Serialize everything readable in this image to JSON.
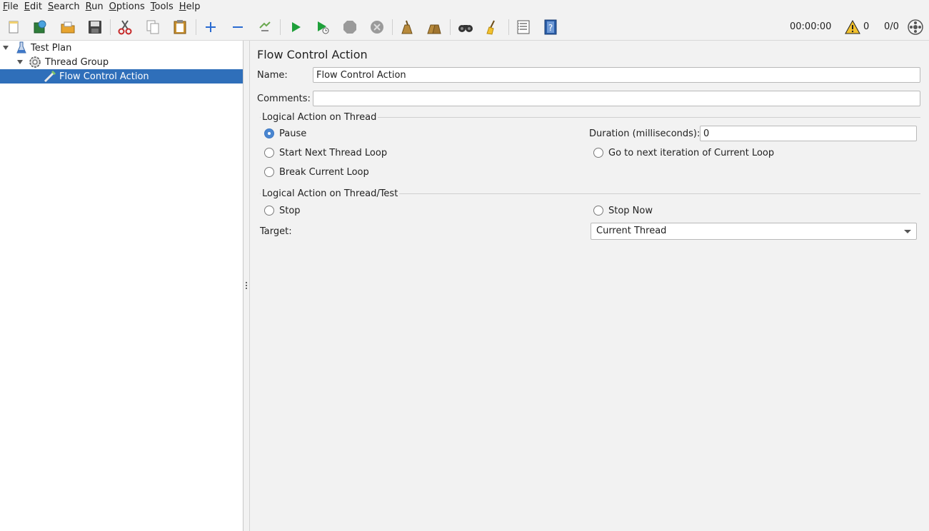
{
  "menu": [
    {
      "mnemonic": "F",
      "rest": "ile"
    },
    {
      "mnemonic": "E",
      "rest": "dit"
    },
    {
      "mnemonic": "S",
      "rest": "earch"
    },
    {
      "mnemonic": "R",
      "rest": "un"
    },
    {
      "mnemonic": "O",
      "rest": "ptions"
    },
    {
      "mnemonic": "T",
      "rest": "ools"
    },
    {
      "mnemonic": "H",
      "rest": "elp"
    }
  ],
  "toolbar": {
    "timer": "00:00:00",
    "warnings": "0",
    "threads": "0/0",
    "icons": [
      "new-icon",
      "templates-icon",
      "open-icon",
      "save-icon",
      "cut-icon",
      "copy-icon",
      "paste-icon",
      "expand-icon",
      "collapse-icon",
      "toggle-icon",
      "start-icon",
      "start-no-pauses-icon",
      "stop-icon",
      "shutdown-icon",
      "clear-icon",
      "clear-all-icon",
      "search-icon",
      "reset-search-icon",
      "function-helper-icon",
      "help-icon",
      "remote-status-icon"
    ]
  },
  "tree": {
    "items": [
      {
        "label": "Test Plan",
        "icon": "test-plan-icon"
      },
      {
        "label": "Thread Group",
        "icon": "thread-group-icon"
      },
      {
        "label": "Flow Control Action",
        "icon": "flow-control-icon",
        "selected": true
      }
    ]
  },
  "panel": {
    "title": "Flow Control Action",
    "name_label": "Name:",
    "name_value": "Flow Control Action",
    "comments_label": "Comments:",
    "comments_value": "",
    "group1": {
      "title": "Logical Action on Thread",
      "pause": "Pause",
      "start_next": "Start Next Thread Loop",
      "break_loop": "Break Current Loop",
      "duration_label": "Duration (milliseconds):",
      "duration_value": "0",
      "go_next": "Go to next iteration of Current Loop",
      "selected": "Pause"
    },
    "group2": {
      "title": "Logical Action on Thread/Test",
      "stop": "Stop",
      "stop_now": "Stop Now"
    },
    "target_label": "Target:",
    "target_value": "Current Thread"
  },
  "colors": {
    "selection": "#2f6fba",
    "accent": "#4a86d0"
  }
}
